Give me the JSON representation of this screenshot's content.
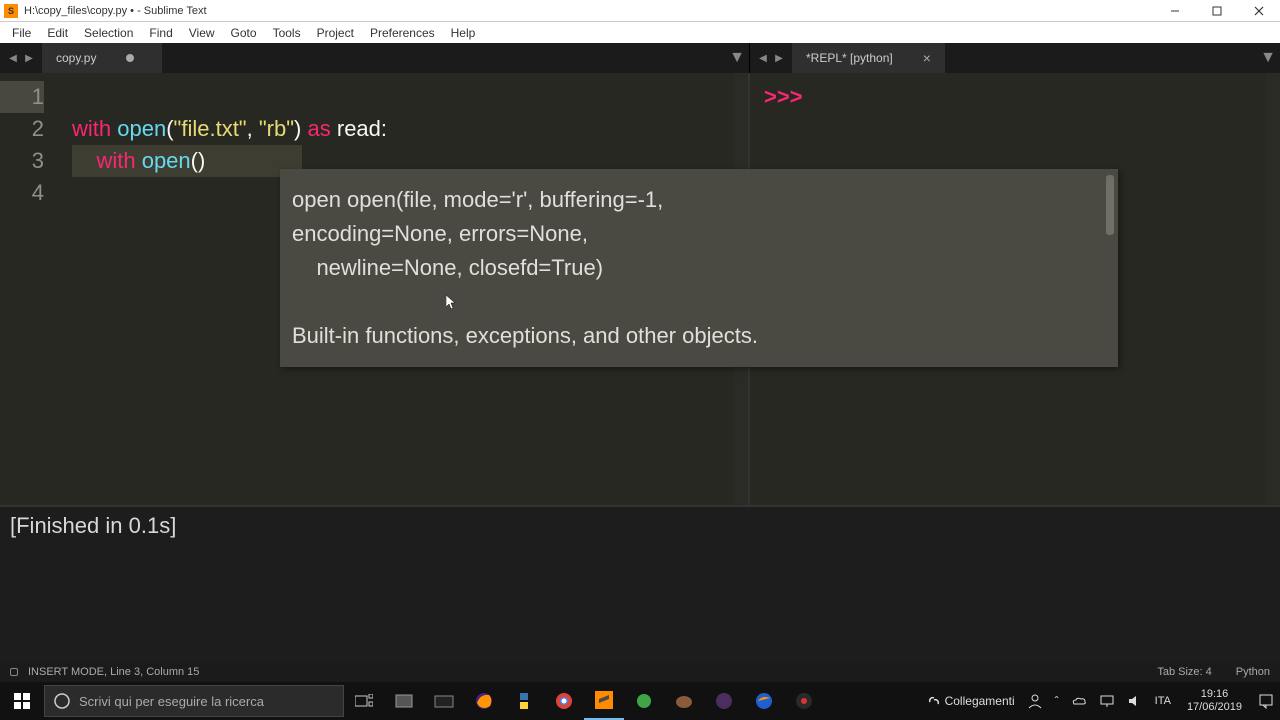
{
  "window": {
    "title": "H:\\copy_files\\copy.py • - Sublime Text"
  },
  "menu": [
    "File",
    "Edit",
    "Selection",
    "Find",
    "View",
    "Goto",
    "Tools",
    "Project",
    "Preferences",
    "Help"
  ],
  "tabs": {
    "left": {
      "label": "copy.py",
      "dirty": true
    },
    "right": {
      "label": "*REPL* [python]"
    }
  },
  "code": {
    "lines": [
      "1",
      "2",
      "3",
      "4"
    ],
    "l2": {
      "with": "with",
      "open": "open",
      "lp": "(",
      "s1": "\"file.txt\"",
      "c": ", ",
      "s2": "\"rb\"",
      "rp": ")",
      "as": "as",
      "id": "read",
      "col": ":"
    },
    "l3": {
      "with": "with",
      "open": "open",
      "lp": "(",
      "rp": ")"
    }
  },
  "tooltip": {
    "sig1": "open open(file, mode='r', buffering=-1,",
    "sig2": "encoding=None, errors=None,",
    "sig3": "    newline=None, closefd=True)",
    "doc": "Built-in functions, exceptions, and other objects."
  },
  "repl": {
    "prompt": ">>>"
  },
  "build": {
    "text": "[Finished in 0.1s]"
  },
  "status": {
    "left": "INSERT MODE, Line 3, Column 15",
    "tabsize": "Tab Size: 4",
    "syntax": "Python"
  },
  "taskbar": {
    "search_placeholder": "Scrivi qui per eseguire la ricerca",
    "link_label": "Collegamenti",
    "time": "19:16",
    "date": "17/06/2019"
  }
}
